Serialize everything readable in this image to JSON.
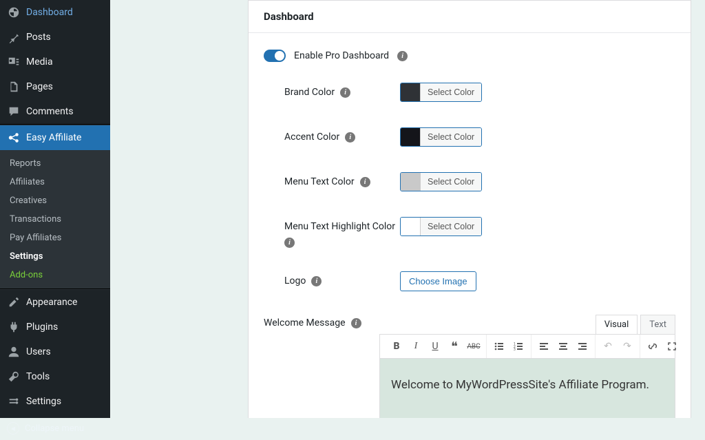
{
  "sidebar": {
    "main": [
      {
        "label": "Dashboard",
        "icon": "dashboard"
      },
      {
        "label": "Posts",
        "icon": "pin"
      },
      {
        "label": "Media",
        "icon": "media"
      },
      {
        "label": "Pages",
        "icon": "page"
      },
      {
        "label": "Comments",
        "icon": "comment"
      }
    ],
    "active": {
      "label": "Easy Affiliate",
      "icon": "affiliate"
    },
    "submenu": [
      {
        "label": "Reports"
      },
      {
        "label": "Affiliates"
      },
      {
        "label": "Creatives"
      },
      {
        "label": "Transactions"
      },
      {
        "label": "Pay Affiliates"
      },
      {
        "label": "Settings",
        "current": true
      },
      {
        "label": "Add-ons",
        "accent": true
      }
    ],
    "lower": [
      {
        "label": "Appearance",
        "icon": "appearance"
      },
      {
        "label": "Plugins",
        "icon": "plugin"
      },
      {
        "label": "Users",
        "icon": "user"
      },
      {
        "label": "Tools",
        "icon": "tools"
      },
      {
        "label": "Settings",
        "icon": "settings"
      }
    ],
    "collapse": "Collapse menu"
  },
  "panel": {
    "title": "Dashboard",
    "toggle": {
      "label": "Enable Pro Dashboard",
      "on": true
    },
    "fields": {
      "brand_color": {
        "label": "Brand Color",
        "swatch": "#2f3236",
        "button": "Select Color"
      },
      "accent_color": {
        "label": "Accent Color",
        "swatch": "#14151a",
        "button": "Select Color"
      },
      "menu_text_color": {
        "label": "Menu Text Color",
        "swatch": "#c9c9c9",
        "button": "Select Color"
      },
      "menu_text_highlight_color": {
        "label": "Menu Text Highlight Color",
        "swatch": "#ffffff",
        "button": "Select Color"
      },
      "logo": {
        "label": "Logo",
        "button": "Choose Image"
      },
      "welcome_message": {
        "label": "Welcome Message"
      }
    },
    "editor": {
      "tabs": {
        "visual": "Visual",
        "text": "Text"
      },
      "content": "Welcome to MyWordPressSite's Affiliate Program."
    }
  }
}
